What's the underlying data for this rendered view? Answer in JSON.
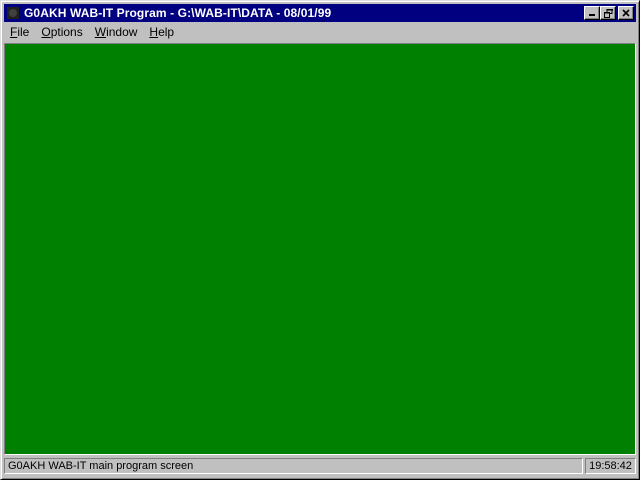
{
  "window": {
    "title": "G0AKH WAB-IT Program - G:\\WAB-IT\\DATA - 08/01/99"
  },
  "menu": {
    "file": {
      "mnemonic": "F",
      "rest": "ile"
    },
    "options": {
      "mnemonic": "O",
      "rest": "ptions"
    },
    "window": {
      "mnemonic": "W",
      "rest": "indow"
    },
    "help": {
      "mnemonic": "H",
      "rest": "elp"
    }
  },
  "status": {
    "message": "G0AKH WAB-IT main program screen",
    "time": "19:58:42"
  },
  "colors": {
    "titlebar": "#000080",
    "client_background": "#008000",
    "chrome": "#c0c0c0"
  },
  "icons": {
    "app": "app-icon",
    "minimize": "minimize-icon",
    "restore": "restore-icon",
    "close": "close-icon"
  }
}
